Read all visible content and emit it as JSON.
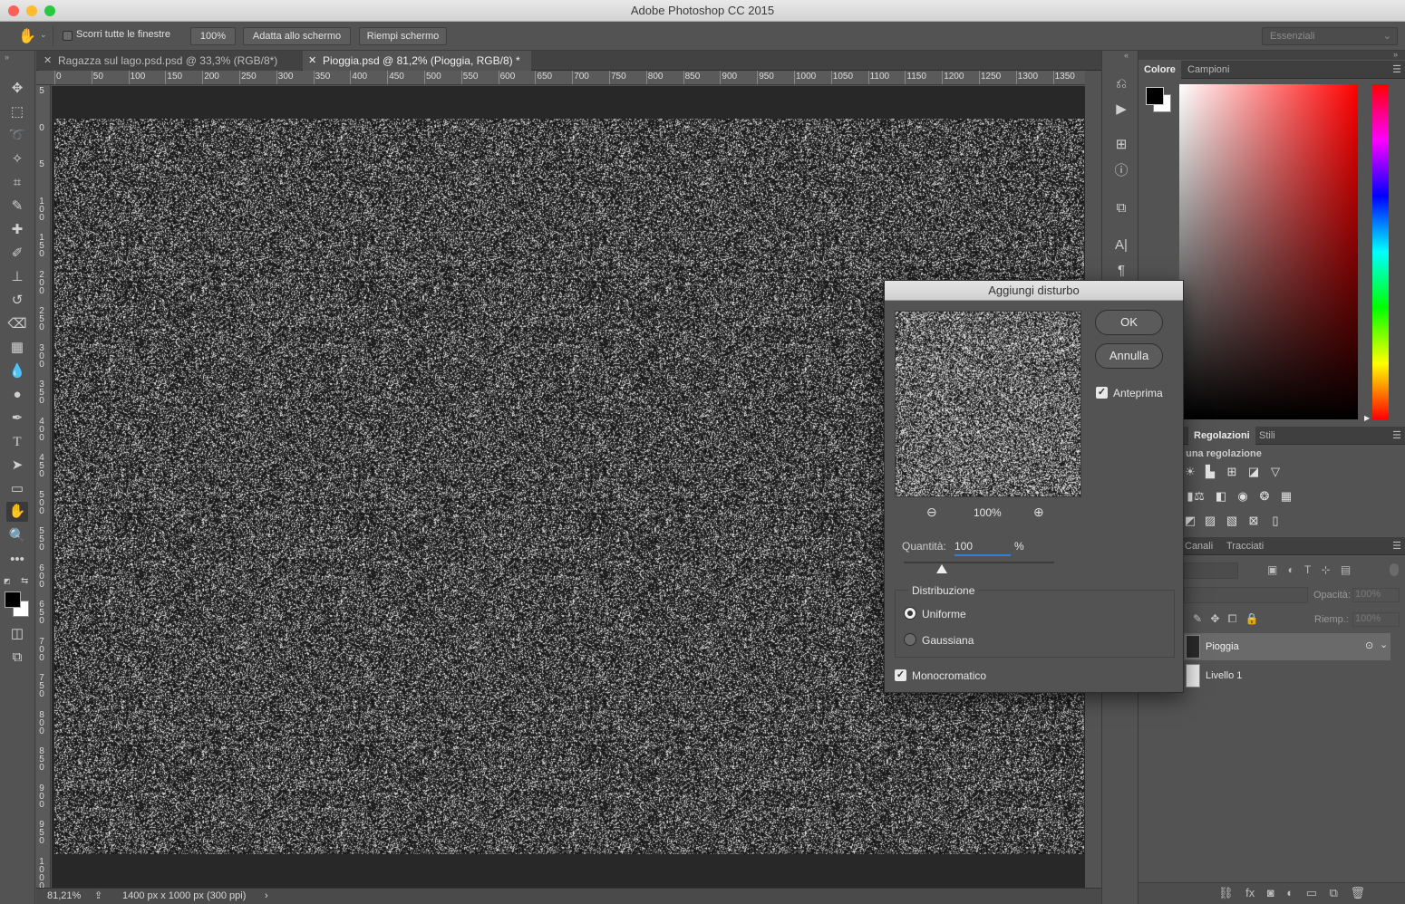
{
  "window": {
    "title": "Adobe Photoshop CC 2015"
  },
  "options_bar": {
    "scroll_all_windows_label": "Scorri tutte le finestre",
    "zoom_100_label": "100%",
    "fit_screen_label": "Adatta allo schermo",
    "fill_screen_label": "Riempi schermo",
    "workspace_select": "Essenziali"
  },
  "tabs": [
    {
      "label": "Ragazza sul lago.psd.psd @ 33,3% (RGB/8*)",
      "active": false
    },
    {
      "label": "Pioggia.psd @ 81,2% (Pioggia, RGB/8) *",
      "active": true
    }
  ],
  "ruler_h": [
    "0",
    "50",
    "100",
    "150",
    "200",
    "250",
    "300",
    "350",
    "400",
    "450",
    "500",
    "550",
    "600",
    "650",
    "700",
    "750",
    "800",
    "850",
    "900",
    "950",
    "1000",
    "1050",
    "1100",
    "1150",
    "1200",
    "1250",
    "1300",
    "1350"
  ],
  "ruler_v": [
    "5",
    "0",
    "5",
    "1 0 0",
    "1 5 0",
    "2 0 0",
    "2 5 0",
    "3 0 0",
    "3 5 0",
    "4 0 0",
    "4 5 0",
    "5 0 0",
    "5 5 0",
    "6 0 0",
    "6 5 0",
    "7 0 0",
    "7 5 0",
    "8 0 0",
    "8 5 0",
    "9 0 0",
    "9 5 0",
    "1 0 0 0"
  ],
  "status": {
    "zoom": "81,21%",
    "doc_info": "1400 px x 1000 px (300 ppi)"
  },
  "color_panel": {
    "tabs": [
      "Colore",
      "Campioni"
    ]
  },
  "adjust_panel": {
    "tabs": [
      "Regolazioni",
      "Stili"
    ],
    "hint": "l una regolazione"
  },
  "layers_panel": {
    "tabs": [
      "Canali",
      "Tracciati"
    ],
    "opacity_label": "Opacità:",
    "opacity_value": "100%",
    "fill_label": "Riemp.:",
    "fill_value": "100%",
    "layers": [
      {
        "name": "Pioggia",
        "selected": true
      },
      {
        "name": "Livello 1",
        "selected": false
      }
    ]
  },
  "dialog": {
    "title": "Aggiungi disturbo",
    "ok_label": "OK",
    "cancel_label": "Annulla",
    "preview_label": "Anteprima",
    "preview_checked": true,
    "zoom_label": "100%",
    "amount_label": "Quantità:",
    "amount_value": "100",
    "amount_unit": "%",
    "amount_slider_fraction": 0.25,
    "distribution_label": "Distribuzione",
    "uniform_label": "Uniforme",
    "gaussian_label": "Gaussiana",
    "distribution_selected": "Uniforme",
    "monochromatic_label": "Monocromatico",
    "monochromatic_checked": true
  },
  "colors": {
    "foreground": "#000000",
    "background": "#ffffff",
    "accent": "#2f7fe0"
  }
}
